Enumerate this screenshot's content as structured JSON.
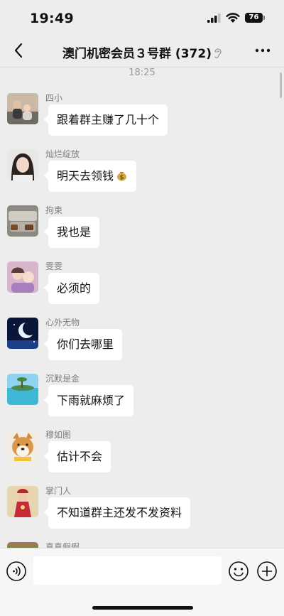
{
  "status_bar": {
    "time": "19:49",
    "battery": "76"
  },
  "nav": {
    "title": "澳门机密会员３号群 (372)"
  },
  "chat": {
    "timestamp": "18:25",
    "messages": [
      {
        "sender": "四小",
        "text": "跟着群主赚了几十个"
      },
      {
        "sender": "灿烂绽放",
        "text": "明天去领钱"
      },
      {
        "sender": "拘束",
        "text": "我也是"
      },
      {
        "sender": "雯雯",
        "text": "必须的"
      },
      {
        "sender": "心外无物",
        "text": "你们去哪里"
      },
      {
        "sender": "沉默是金",
        "text": "下雨就麻烦了"
      },
      {
        "sender": "穆如图",
        "text": "估计不会"
      },
      {
        "sender": "掌门人",
        "text": "不知道群主还发不发资料"
      },
      {
        "sender": "真真假假",
        "text": ""
      }
    ]
  },
  "input": {
    "value": ""
  }
}
